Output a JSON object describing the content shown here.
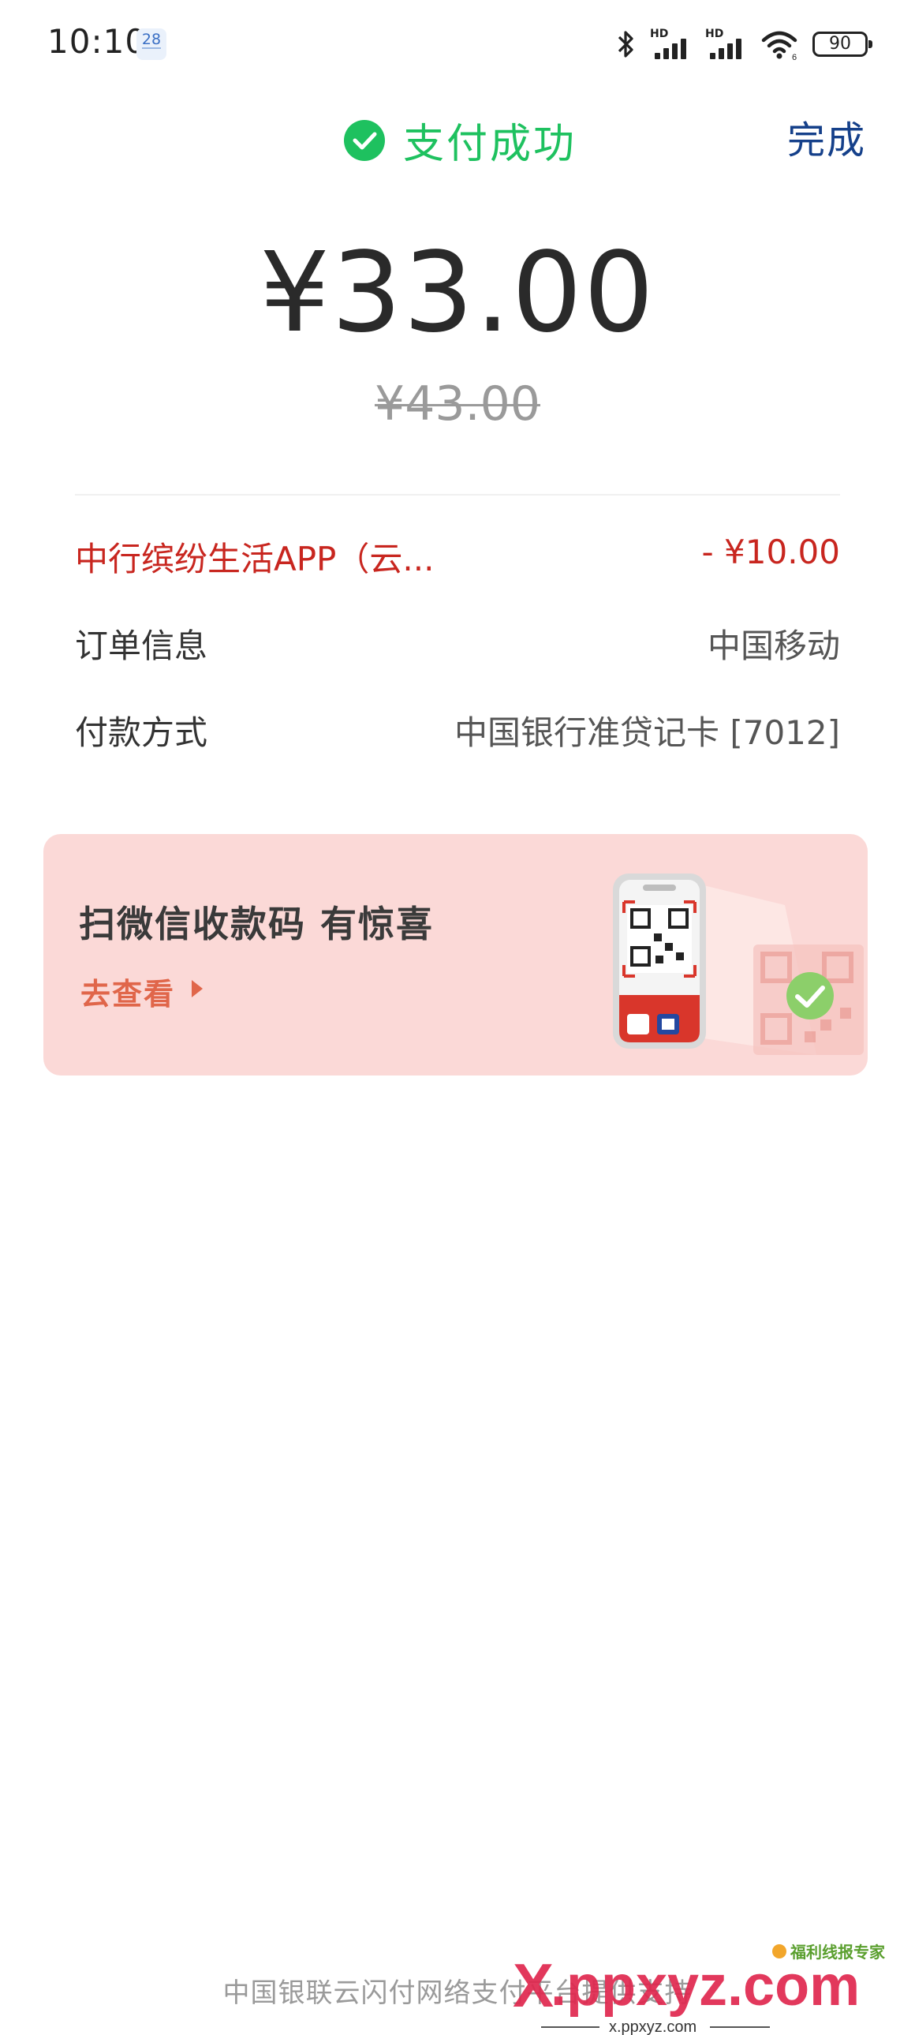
{
  "status_bar": {
    "time": "10:10",
    "calendar_day": "28",
    "network_left": "HD",
    "network_right": "HD",
    "battery": "90"
  },
  "header": {
    "title": "支付成功",
    "done_label": "完成",
    "success_color": "#1ec15f"
  },
  "amount": {
    "paid": "¥33.00",
    "original": "¥43.00"
  },
  "details": {
    "discount_label": "中行缤纷生活APP（云...",
    "discount_value": "- ¥10.00",
    "order_label": "订单信息",
    "order_value": "中国移动",
    "payment_label": "付款方式",
    "payment_value": "中国银行准贷记卡 [7012]"
  },
  "promo": {
    "title": "扫微信收款码 有惊喜",
    "link": "去查看"
  },
  "footer": {
    "text": "中国银联云闪付网络支付平台提供支持"
  },
  "watermark": {
    "top_text": "福利线报专家",
    "main_text": "x.ppxyz.com",
    "sub_text": "x.ppxyz.com"
  }
}
